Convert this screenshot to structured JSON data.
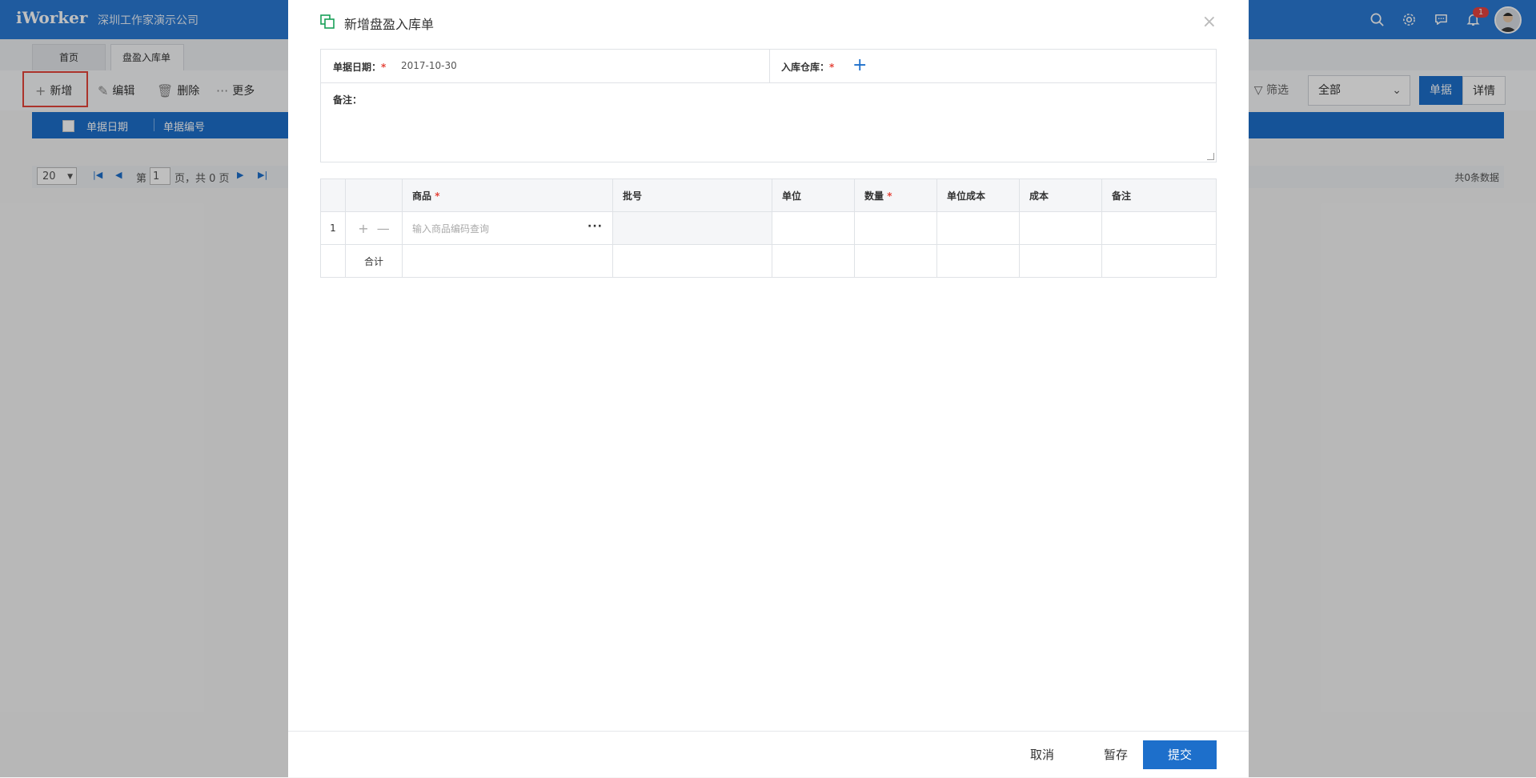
{
  "header": {
    "brand": "iWorker",
    "company": "深圳工作家演示公司",
    "notification_count": "1",
    "icons": [
      "search-icon",
      "gear-icon",
      "chat-icon",
      "bell-icon"
    ]
  },
  "tabs": [
    {
      "label": "首页"
    },
    {
      "label": "盘盈入库单",
      "close": "×"
    }
  ],
  "toolbar": {
    "new": "新增",
    "edit": "编辑",
    "delete": "删除",
    "more": "更多",
    "filter": "筛选",
    "scope": "全部",
    "view_doc": "单据",
    "view_detail": "详情"
  },
  "grid": {
    "columns": [
      "单据日期",
      "单据编号"
    ]
  },
  "pager": {
    "page_size": "20",
    "page_prefix": "第",
    "page_value": "1",
    "page_suffix": "页，共 0 页",
    "total": "共0条数据"
  },
  "modal": {
    "title": "新增盘盈入库单",
    "close": "×",
    "date_label": "单据日期：",
    "date_value": "2017-10-30",
    "warehouse_label": "入库仓库：",
    "note_label": "备注：",
    "required_mark": "*",
    "table": {
      "headers": [
        "商品",
        "批号",
        "单位",
        "数量",
        "单位成本",
        "成本",
        "备注"
      ],
      "row_number": "1",
      "product_placeholder": "输入商品编码查询",
      "more": "···",
      "total_label": "合计"
    },
    "buttons": {
      "cancel": "取消",
      "save_draft": "暂存",
      "submit": "提交"
    }
  },
  "colors": {
    "primary": "#1d6fcb",
    "header_bg": "#2a7ad4",
    "required": "#e5453a",
    "highlight": "#e5453a"
  }
}
